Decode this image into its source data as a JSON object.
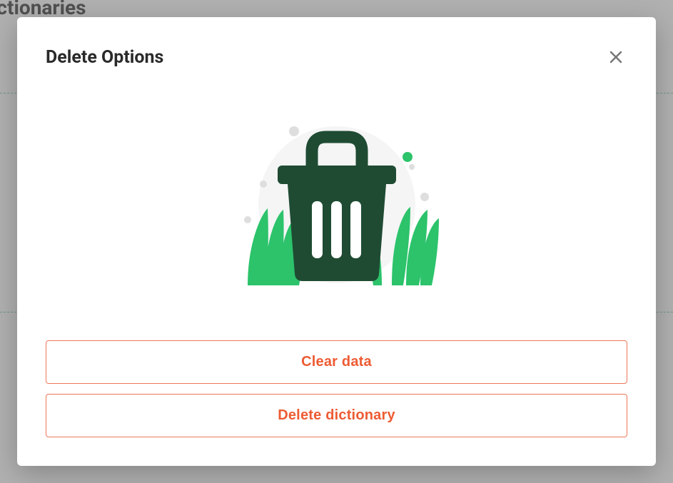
{
  "page": {
    "heading_fragment": "ictionaries"
  },
  "modal": {
    "title": "Delete Options",
    "buttons": {
      "clear_data": "Clear data",
      "delete_dictionary": "Delete dictionary"
    }
  }
}
